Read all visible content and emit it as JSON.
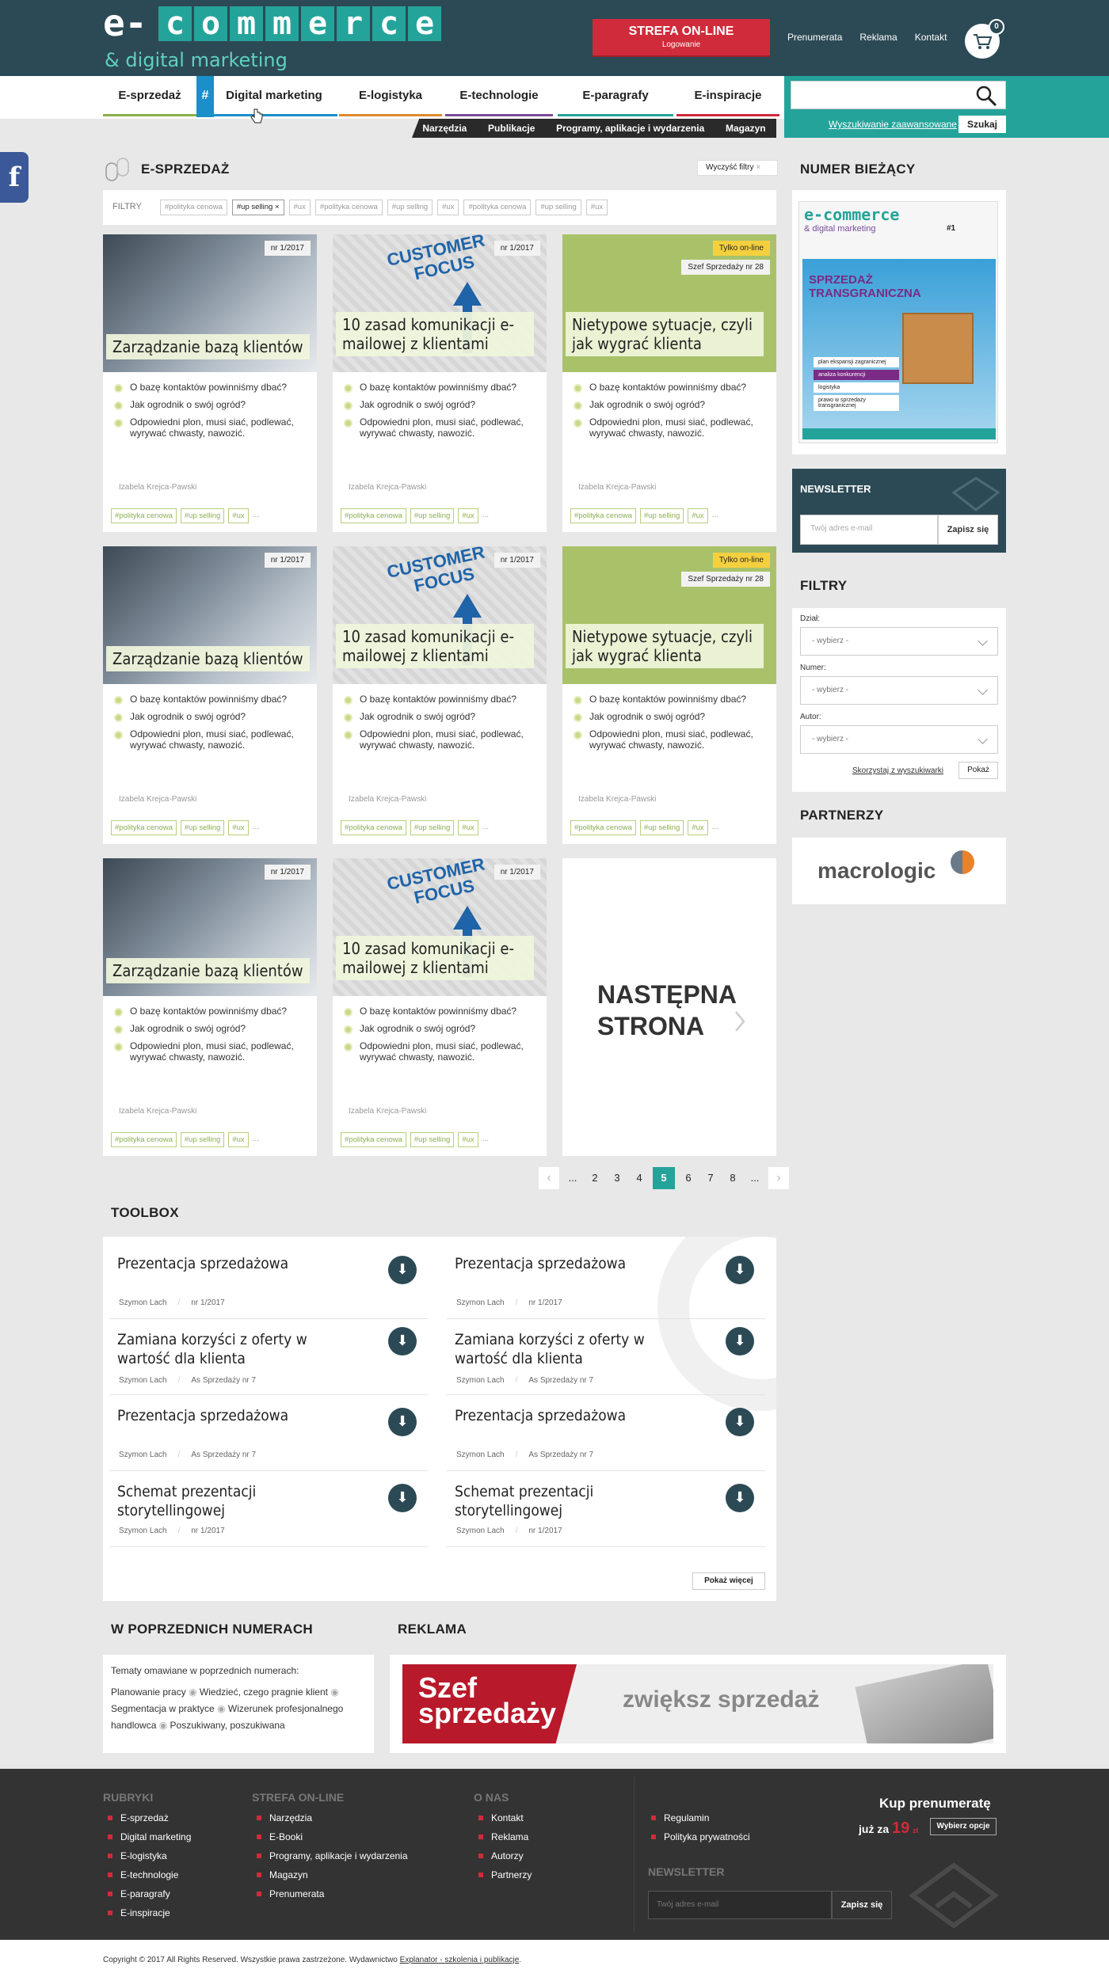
{
  "header": {
    "logo_e": "e-",
    "logo_word": [
      "c",
      "o",
      "m",
      "m",
      "e",
      "r",
      "c",
      "e"
    ],
    "logo_sub": "& digital marketing",
    "strefa_title": "STREFA ON-LINE",
    "strefa_sub": "Logowanie",
    "links": [
      "Prenumerata",
      "Reklama",
      "Kontakt"
    ],
    "cart_count": "0"
  },
  "nav": {
    "items": [
      "E-sprzedaż",
      "Digital marketing",
      "E-logistyka",
      "E-technologie",
      "E-paragrafy",
      "E-inspiracje"
    ],
    "hash": "#",
    "colors": [
      "#8cb04a",
      "#1a8fc9",
      "#e08a2e",
      "#7b4b9a",
      "#24a39a",
      "#d02b3a"
    ],
    "sub": [
      "Narzędzia",
      "Publikacje",
      "Programy, aplikacje i wydarzenia",
      "Magazyn"
    ],
    "search_placeholder": "",
    "advanced": "Wyszukiwanie zaawansowane",
    "search_btn": "Szukaj"
  },
  "social": {
    "fb": "f"
  },
  "main": {
    "section_title": "E-SPRZEDAŻ",
    "clear_filters": "Wyczyść filtry",
    "filters_label": "FILTRY",
    "filter_tags": [
      "#polityka cenowa",
      "#up selling",
      "#ux",
      "#polityka cenowa",
      "#up selling",
      "#ux",
      "#polityka cenowa",
      "#up selling",
      "#ux"
    ],
    "selected_tag": "#up selling",
    "cards": [
      {
        "title": "Zarządzanie bazą klientów",
        "badge": "nr 1/2017",
        "bullets": [
          "O bazę kontaktów powinniśmy dbać?",
          "Jak ogrodnik o swój ogród?",
          "Odpowiedni plon, musi siać, podlewać, wyrywać chwasty, nawozić."
        ],
        "author": "Izabela Krejca-Pawski",
        "tags": [
          "#polityka cenowa",
          "#up selling",
          "#ux"
        ],
        "more": "..."
      },
      {
        "title": "10 zasad komunikacji e-mailowej z klientami",
        "badge": "nr 1/2017",
        "bullets": [
          "O bazę kontaktów powinniśmy dbać?",
          "Jak ogrodnik o swój ogród?",
          "Odpowiedni plon, musi siać, podlewać, wyrywać chwasty, nawozić."
        ],
        "author": "Izabela Krejca-Pawski",
        "tags": [
          "#polityka cenowa",
          "#up selling",
          "#ux"
        ],
        "more": "..."
      },
      {
        "title": "Nietypowe sytuacje, czyli jak wygrać klienta",
        "badge_yellow": "Tylko on-line",
        "badge": "Szef Sprzedaży nr 28",
        "bullets": [
          "O bazę kontaktów powinniśmy dbać?",
          "Jak ogrodnik o swój ogród?",
          "Odpowiedni plon, musi siać, podlewać, wyrywać chwasty, nawozić."
        ],
        "author": "Izabela Krejca-Pawski",
        "tags": [
          "#polityka cenowa",
          "#up selling",
          "#ux"
        ],
        "more": "..."
      }
    ],
    "next_page": [
      "NASTĘPNA",
      "STRONA"
    ],
    "pagination": [
      "...",
      "2",
      "3",
      "4",
      "5",
      "6",
      "7",
      "8",
      "..."
    ],
    "current_page": "5",
    "focus_img_text": [
      "CUSTOMER",
      "FOCUS"
    ]
  },
  "toolbox": {
    "title": "TOOLBOX",
    "items": [
      {
        "title": "Prezentacja sprzedażowa",
        "author": "Szymon Lach",
        "issue": "nr 1/2017"
      },
      {
        "title": "Prezentacja sprzedażowa",
        "author": "Szymon Lach",
        "issue": "nr 1/2017"
      },
      {
        "title": "Zamiana korzyści z oferty w wartość dla klienta",
        "author": "Szymon Lach",
        "issue": "As Sprzedaży nr 7"
      },
      {
        "title": "Zamiana korzyści z oferty w wartość dla klienta",
        "author": "Szymon Lach",
        "issue": "As Sprzedaży nr 7"
      },
      {
        "title": "Prezentacja sprzedażowa",
        "author": "Szymon Lach",
        "issue": "As Sprzedaży nr 7"
      },
      {
        "title": "Prezentacja sprzedażowa",
        "author": "Szymon Lach",
        "issue": "As Sprzedaży nr 7"
      },
      {
        "title": "Schemat prezentacji storytellingowej",
        "author": "Szymon Lach",
        "issue": "nr 1/2017"
      },
      {
        "title": "Schemat prezentacji storytellingowej",
        "author": "Szymon Lach",
        "issue": "nr 1/2017"
      }
    ],
    "more": "Pokaż więcej"
  },
  "previous": {
    "title": "W POPRZEDNICH NUMERACH",
    "intro": "Tematy omawiane w poprzednich numerach:",
    "topics": [
      "Planowanie pracy",
      "Wiedzieć, czego pragnie klient",
      "Segmentacja w praktyce",
      "Wizerunek profesjonalnego handlowca",
      "Poszukiwany, poszukiwana"
    ]
  },
  "ad": {
    "title": "REKLAMA",
    "brand": [
      "Szef",
      "sprzedaży"
    ],
    "slogan": "zwiększ sprzedaż"
  },
  "sidebar": {
    "issue_title": "NUMER BIEŻĄCY",
    "cover_headline": [
      "SPRZEDAŻ",
      "TRANSGRANICZNA"
    ],
    "cover_num": "#1",
    "cover_list": [
      "plan ekspansji zagranicznej",
      "analiza konkurencji",
      "logistyka",
      "prawo w sprzedaży transgranicznej"
    ],
    "newsletter_title": "NEWSLETTER",
    "newsletter_placeholder": "Twój adres e-mail",
    "newsletter_btn": "Zapisz się",
    "filters_title": "FILTRY",
    "filter_labels": [
      "Dział:",
      "Numer:",
      "Autor:"
    ],
    "select_value": "- wybierz -",
    "use_search": "Skorzystaj z wyszukiwarki",
    "show_btn": "Pokaż",
    "partners_title": "PARTNERZY",
    "partner_name": "macrologic"
  },
  "footer": {
    "rubryki_title": "RUBRYKI",
    "rubryki": [
      "E-sprzedaż",
      "Digital marketing",
      "E-logistyka",
      "E-technologie",
      "E-paragrafy",
      "E-inspiracje"
    ],
    "strefa_title": "STREFA ON-LINE",
    "strefa": [
      "Narzędzia",
      "E-Booki",
      "Programy, aplikacje i wydarzenia",
      "Magazyn",
      "Prenumerata"
    ],
    "onas_title": "O NAS",
    "onas": [
      "Kontakt",
      "Reklama",
      "Autorzy",
      "Partnerzy"
    ],
    "legal": [
      "Regulamin",
      "Polityka prywatności"
    ],
    "kup": "Kup prenumeratę",
    "juz_za": "już za",
    "price": "19",
    "currency": "zł",
    "choose": "Wybierz opcje",
    "newsletter_title": "NEWSLETTER",
    "newsletter_placeholder": "Twój adres e-mail",
    "newsletter_btn": "Zapisz się",
    "copyright": "Copyright © 2017 All Rights Reserved. Wszystkie prawa zastrzeżone. Wydawnictwo",
    "publisher": "Explanator - szkolenia i publikacje",
    "dot": "."
  }
}
